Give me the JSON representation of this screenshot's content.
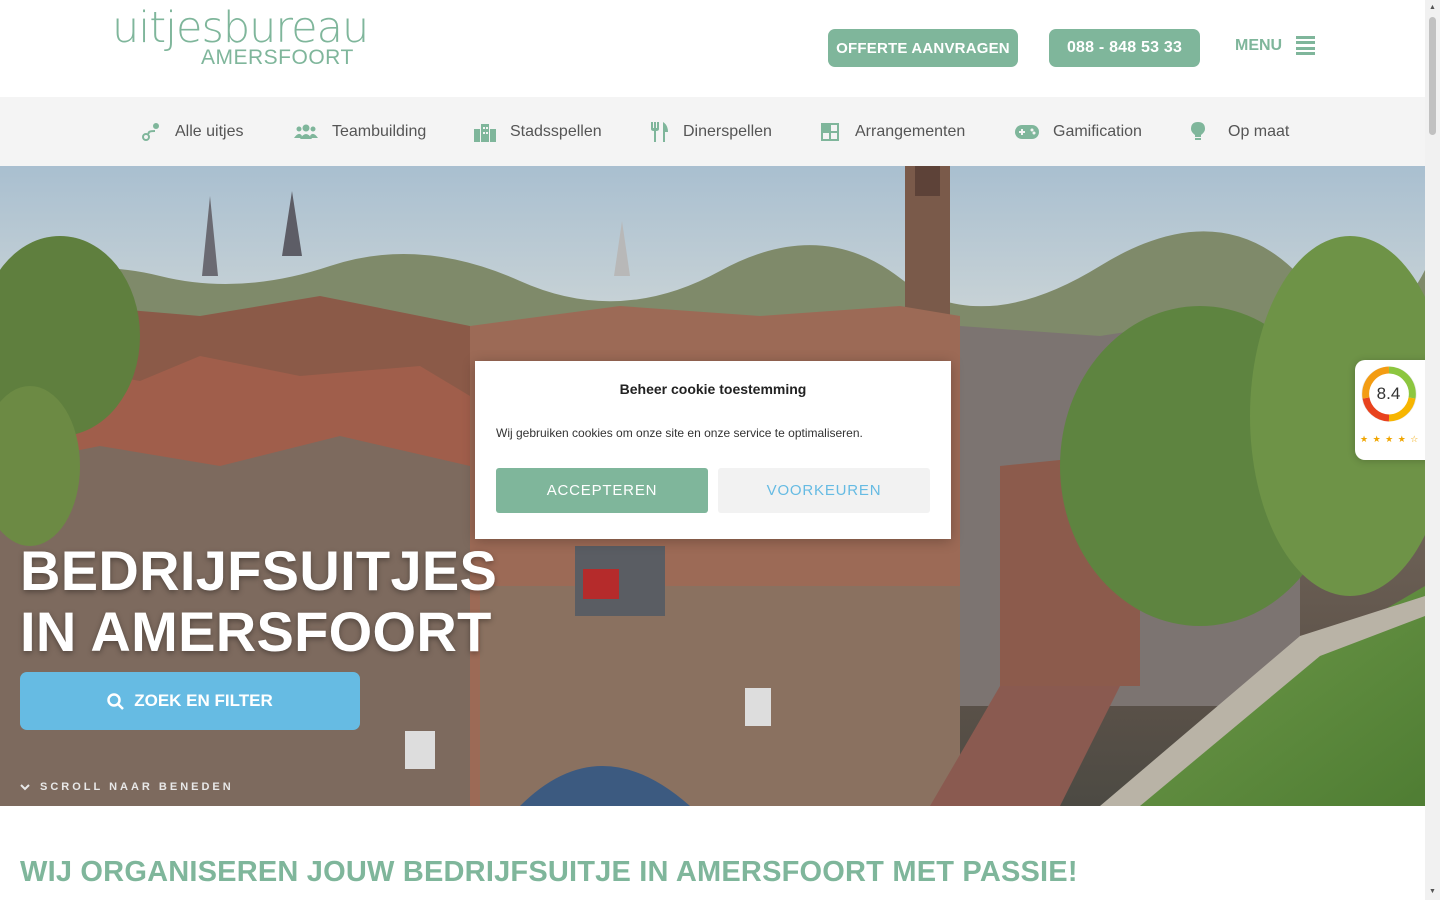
{
  "logo": {
    "main": "uitjesbureau",
    "sub": "AMERSFOORT"
  },
  "header": {
    "offerte_label": "OFFERTE AANVRAGEN",
    "phone_label": "088 - 848 53 33",
    "menu_label": "MENU"
  },
  "nav": {
    "items": [
      {
        "label": "Alle uitjes",
        "icon": "route-icon"
      },
      {
        "label": "Teambuilding",
        "icon": "users-icon"
      },
      {
        "label": "Stadsspellen",
        "icon": "city-icon"
      },
      {
        "label": "Dinerspellen",
        "icon": "utensils-icon"
      },
      {
        "label": "Arrangementen",
        "icon": "grid-icon"
      },
      {
        "label": "Gamification",
        "icon": "gamepad-icon"
      },
      {
        "label": "Op maat",
        "icon": "lightbulb-icon"
      }
    ]
  },
  "hero": {
    "title_line1": "BEDRIJFSUITJES",
    "title_line2": "IN AMERSFOORT",
    "search_label": "ZOEK EN FILTER",
    "scroll_label": "SCROLL NAAR BENEDEN"
  },
  "cookie": {
    "title": "Beheer cookie toestemming",
    "text": "Wij gebruiken cookies om onze site en onze service te optimaliseren.",
    "accept_label": "ACCEPTEREN",
    "prefs_label": "VOORKEUREN"
  },
  "rating": {
    "score": "8.4",
    "stars_full": 4,
    "stars_total": 5,
    "stars": "★ ★ ★ ★ ☆"
  },
  "intro": {
    "heading": "WIJ ORGANISEREN JOUW BEDRIJFSUITJE IN AMERSFOORT MET PASSIE!"
  },
  "colors": {
    "brand_green": "#7fb69b",
    "accent_blue": "#66bbe3",
    "nav_bg": "#f4f4f4",
    "nav_icon": "#7fb69b"
  }
}
